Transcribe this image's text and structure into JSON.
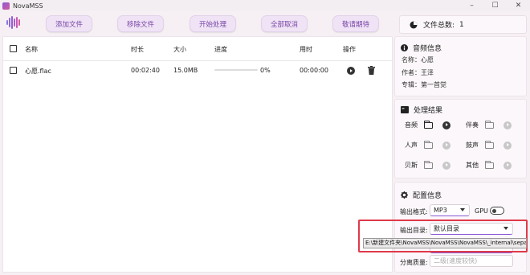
{
  "window": {
    "title": "NovaMSS",
    "controls": [
      "–",
      "☐",
      "✕"
    ]
  },
  "toolbar": {
    "buttons": [
      "添加文件",
      "移除文件",
      "开始处理",
      "全部取消",
      "敬请期待"
    ]
  },
  "file_count": {
    "label": "文件总数:",
    "value": "1"
  },
  "table": {
    "headers": {
      "name": "名称",
      "duration": "时长",
      "size": "大小",
      "progress": "进度",
      "elapsed": "用时",
      "actions": "操作"
    },
    "rows": [
      {
        "name": "心愿.flac",
        "duration": "00:02:40",
        "size": "15.0MB",
        "progress_percent": "0%",
        "progress_value": 0,
        "elapsed": "00:00:00"
      }
    ]
  },
  "audio_info": {
    "title": "音频信息",
    "name": "名称：心愿",
    "artist": "作者：王泽",
    "album": "专辑：第一首觉"
  },
  "results": {
    "title": "处理结果",
    "items": [
      "音频",
      "伴奏",
      "人声",
      "鼓声",
      "贝斯",
      "其他"
    ]
  },
  "config": {
    "title": "配置信息",
    "format_label": "输出格式:",
    "format_value": "MP3",
    "gpu_label": "GPU",
    "gpu_enabled": false,
    "output_label": "输出目录:",
    "output_value": "默认目录",
    "output_tooltip": "E:\\新建文件夹\\NovaMSS\\NovaMSS\\NovaMSS\\_internal\\separation",
    "quality_label": "分离质量:",
    "quality_value": "二级(速度较快)"
  },
  "colors": {
    "accent": "#8a5ad6",
    "highlight": "#e0394a"
  }
}
